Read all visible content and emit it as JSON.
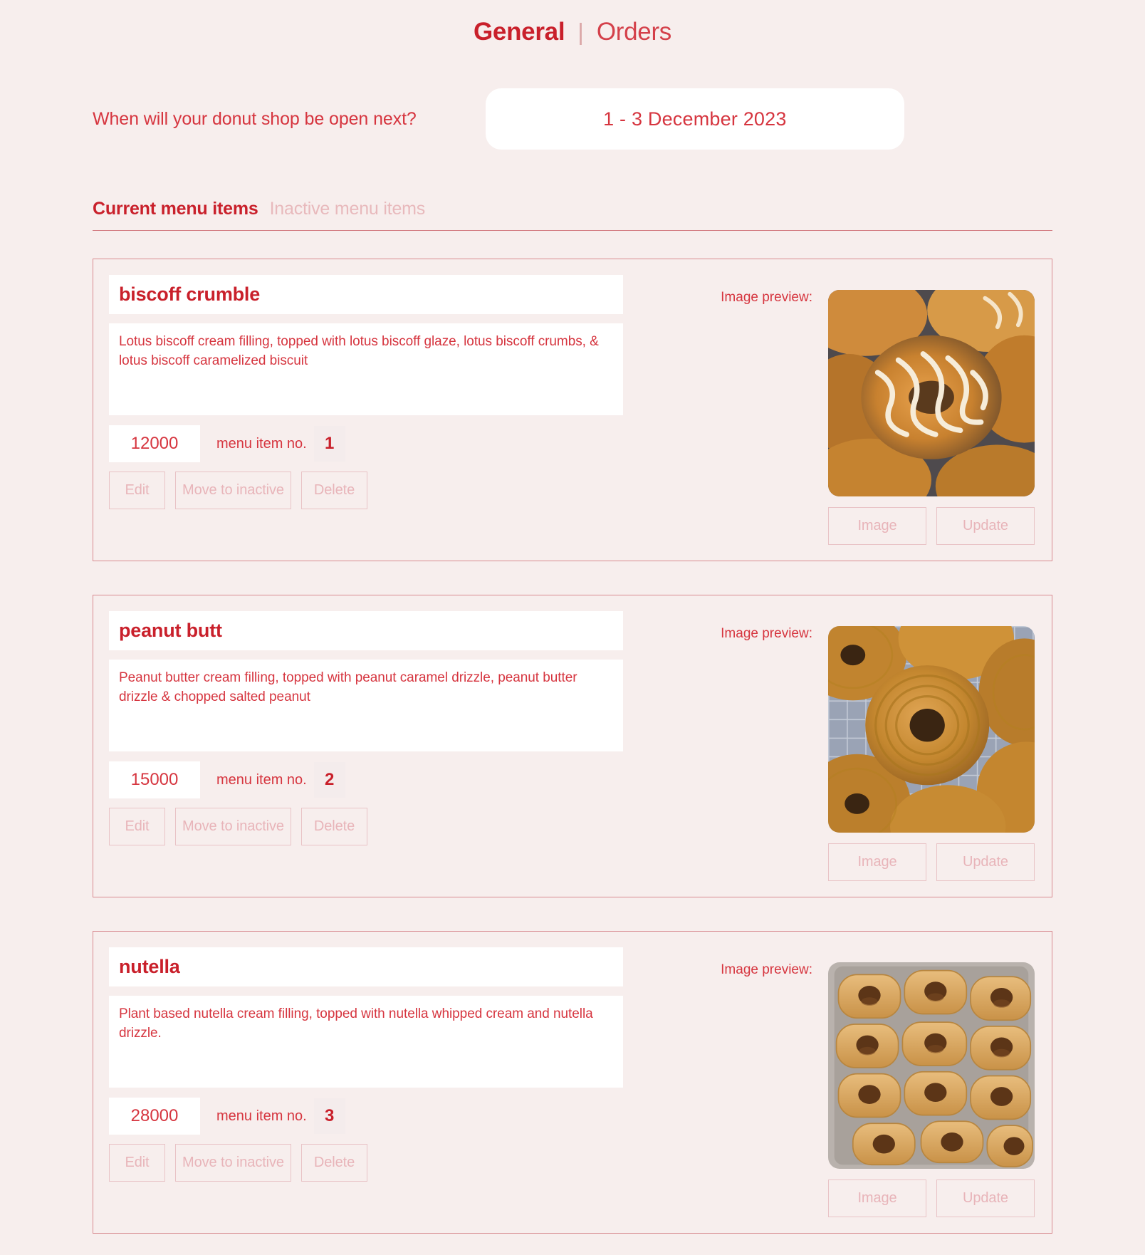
{
  "header": {
    "nav": [
      {
        "label": "General",
        "state": "active"
      },
      {
        "label": "Orders",
        "state": "inactive"
      }
    ],
    "separator": "|"
  },
  "question": {
    "label": "When will your donut shop be open next?",
    "date_value": "1 - 3 December 2023"
  },
  "tabs": [
    {
      "label": "Current menu items",
      "state": "current"
    },
    {
      "label": "Inactive menu items",
      "state": "muted"
    }
  ],
  "labels": {
    "menu_item_no": "menu item no.",
    "image_preview": "Image preview:",
    "edit": "Edit",
    "move_to_inactive": "Move to inactive",
    "delete": "Delete",
    "image": "Image",
    "update": "Update"
  },
  "colors": {
    "page_background": "#f7eeed",
    "brand_red": "#c9202b",
    "text_red": "#d6353f",
    "muted_pink": "#e8b4b9",
    "border_pink": "#d98c91",
    "field_white": "#ffffff"
  },
  "menu_items": [
    {
      "name": "biscoff crumble",
      "description": "Lotus biscoff cream filling, topped with lotus biscoff glaze, lotus biscoff crumbs, & lotus biscoff caramelized biscuit",
      "price": "12000",
      "item_no": "1",
      "image_alt": "caramel glazed donuts with white drizzle"
    },
    {
      "name": "peanut butt",
      "description": "Peanut butter cream filling, topped with peanut caramel drizzle, peanut butter drizzle & chopped salted peanut",
      "price": "15000",
      "item_no": "2",
      "image_alt": "peanut butter glazed cruller donuts on cooling rack"
    },
    {
      "name": "nutella",
      "description": "Plant based nutella cream filling, topped with nutella whipped cream and nutella drizzle.",
      "price": "28000",
      "item_no": "3",
      "image_alt": "sugared nutella filled donuts in a tray"
    }
  ]
}
